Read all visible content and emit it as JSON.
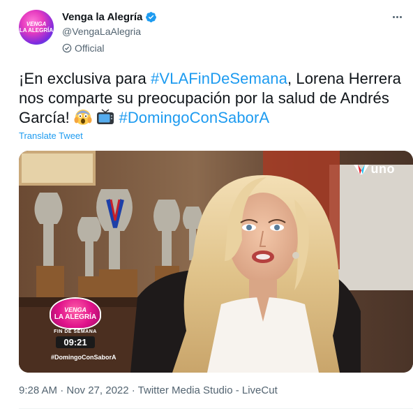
{
  "author": {
    "display_name": "Venga la Alegría",
    "handle": "@VengaLaAlegria",
    "label": "Official",
    "avatar_text": [
      "VENGA",
      "LA ALEGRÍA"
    ]
  },
  "tweet": {
    "text_parts": {
      "p1": "¡En exclusiva para ",
      "h1": "#VLAFinDeSemana",
      "p2": ", Lorena Herrera nos comparte su preocupación por la salud de Andrés García! ",
      "h2": "#DomingoConSaborA"
    },
    "emojis": [
      "face-screaming-in-fear-icon",
      "tv-icon"
    ],
    "translate_label": "Translate Tweet"
  },
  "media": {
    "channel_logo_text": "uno",
    "show_logo": [
      "VENGA",
      "LA ALEGRÍA",
      "FIN DE SEMANA"
    ],
    "clock": "09:21",
    "hashtag_overlay": "#DomingoConSaborA"
  },
  "footer": {
    "meta": "9:28 AM · Nov 27, 2022 · Twitter Media Studio - LiveCut"
  },
  "colors": {
    "accent": "#1d9bf0",
    "text": "#0f1419",
    "secondary": "#536471"
  }
}
